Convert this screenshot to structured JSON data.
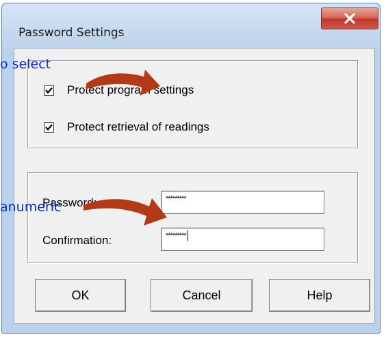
{
  "window": {
    "title": "Password Settings",
    "close_glyph": "X"
  },
  "options": {
    "protect_settings": {
      "label": "Protect program settings",
      "checked": true
    },
    "protect_readings": {
      "label": "Protect retrieval of readings",
      "checked": true
    }
  },
  "password": {
    "password_label": "Password:",
    "password_value": "*********",
    "confirmation_label": "Confirmation:",
    "confirmation_value": "*********"
  },
  "buttons": {
    "ok": "OK",
    "cancel": "Cancel",
    "help": "Help"
  },
  "annotations": {
    "top": "o select",
    "middle": "anumeric",
    "arrow_color": "#b33a14",
    "text_color": "#0b2bd8"
  }
}
